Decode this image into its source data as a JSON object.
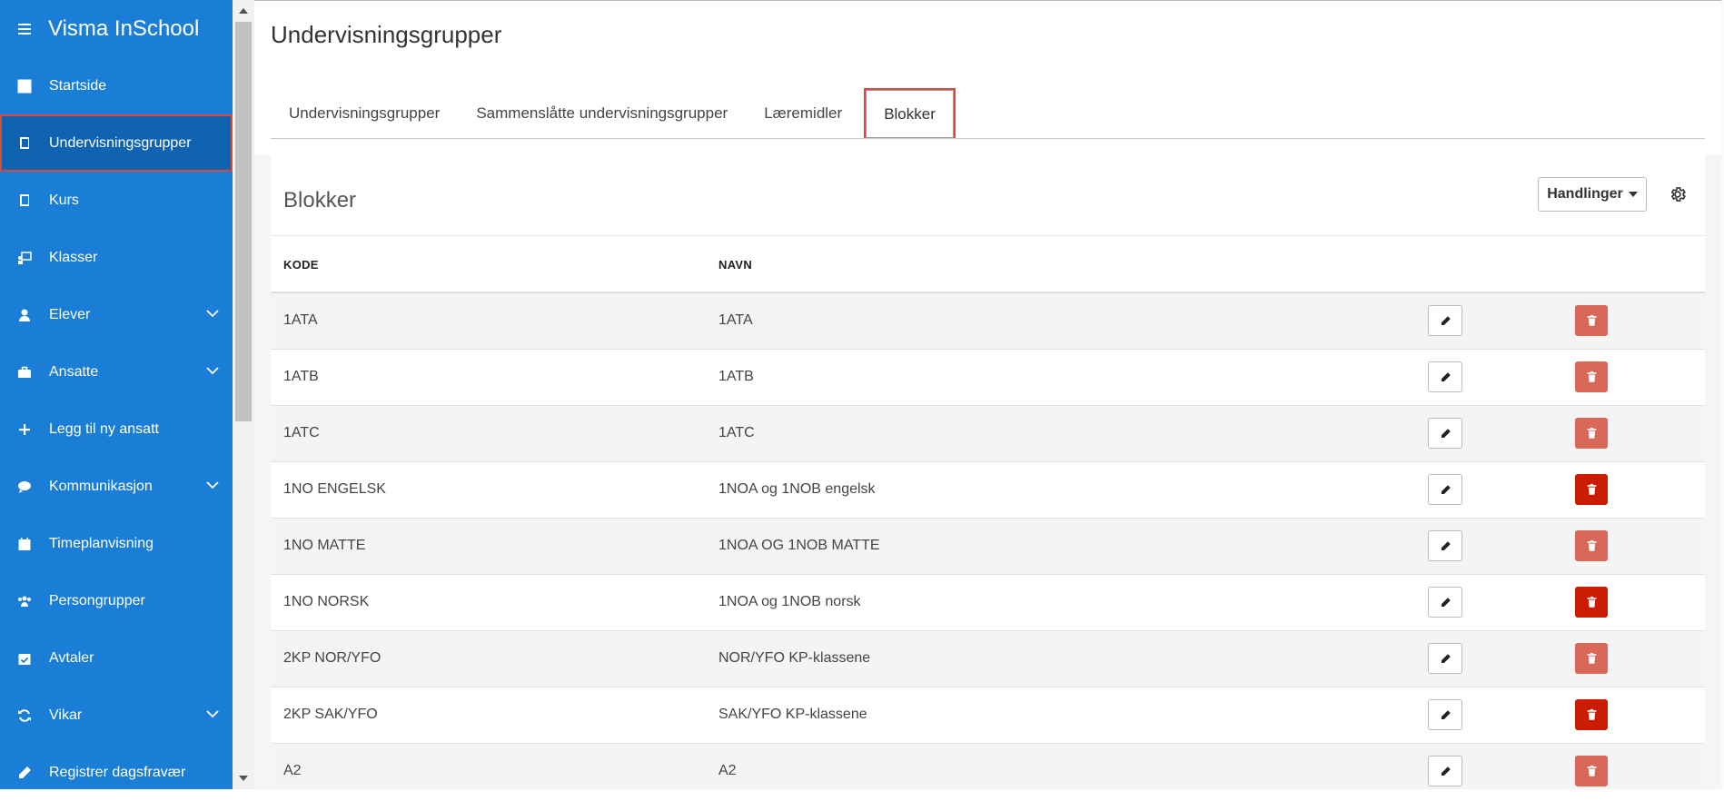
{
  "app": {
    "title": "Visma InSchool"
  },
  "sidebar": {
    "items": [
      {
        "label": "Startside",
        "icon": "grid-icon",
        "expandable": false
      },
      {
        "label": "Undervisningsgrupper",
        "icon": "book-icon",
        "expandable": false,
        "active": true
      },
      {
        "label": "Kurs",
        "icon": "book-icon",
        "expandable": false
      },
      {
        "label": "Klasser",
        "icon": "classroom-icon",
        "expandable": false
      },
      {
        "label": "Elever",
        "icon": "student-icon",
        "expandable": true
      },
      {
        "label": "Ansatte",
        "icon": "briefcase-icon",
        "expandable": true
      },
      {
        "label": "Legg til ny ansatt",
        "icon": "plus-icon",
        "expandable": false
      },
      {
        "label": "Kommunikasjon",
        "icon": "chat-icon",
        "expandable": true
      },
      {
        "label": "Timeplanvisning",
        "icon": "calendar-icon",
        "expandable": false
      },
      {
        "label": "Persongrupper",
        "icon": "people-icon",
        "expandable": false
      },
      {
        "label": "Avtaler",
        "icon": "calendar-check-icon",
        "expandable": false
      },
      {
        "label": "Vikar",
        "icon": "refresh-icon",
        "expandable": true
      },
      {
        "label": "Registrer dagsfravær",
        "icon": "pencil-icon",
        "expandable": false
      }
    ]
  },
  "page": {
    "title": "Undervisningsgrupper"
  },
  "tabs": [
    {
      "label": "Undervisningsgrupper",
      "active": false
    },
    {
      "label": "Sammenslåtte undervisningsgrupper",
      "active": false
    },
    {
      "label": "Læremidler",
      "active": false
    },
    {
      "label": "Blokker",
      "active": true
    }
  ],
  "card": {
    "title": "Blokker",
    "actions_label": "Handlinger",
    "columns": {
      "code": "KODE",
      "name": "NAVN"
    },
    "rows": [
      {
        "code": "1ATA",
        "name": "1ATA",
        "delete_style": "dim"
      },
      {
        "code": "1ATB",
        "name": "1ATB",
        "delete_style": "dim"
      },
      {
        "code": "1ATC",
        "name": "1ATC",
        "delete_style": "dim"
      },
      {
        "code": "1NO ENGELSK",
        "name": "1NOA og 1NOB engelsk",
        "delete_style": "strong"
      },
      {
        "code": "1NO MATTE",
        "name": "1NOA OG 1NOB MATTE",
        "delete_style": "dim"
      },
      {
        "code": "1NO NORSK",
        "name": "1NOA og 1NOB norsk",
        "delete_style": "strong"
      },
      {
        "code": "2KP NOR/YFO",
        "name": "NOR/YFO KP-klassene",
        "delete_style": "dim"
      },
      {
        "code": "2KP SAK/YFO",
        "name": "SAK/YFO KP-klassene",
        "delete_style": "strong"
      },
      {
        "code": "A2",
        "name": "A2",
        "delete_style": "dim"
      }
    ]
  },
  "colors": {
    "sidebar_bg": "#1a7ed6",
    "sidebar_active_bg": "#1063b0",
    "highlight_outline": "#d9493e",
    "delete_dim": "#d96758",
    "delete_strong": "#cc1c00"
  }
}
